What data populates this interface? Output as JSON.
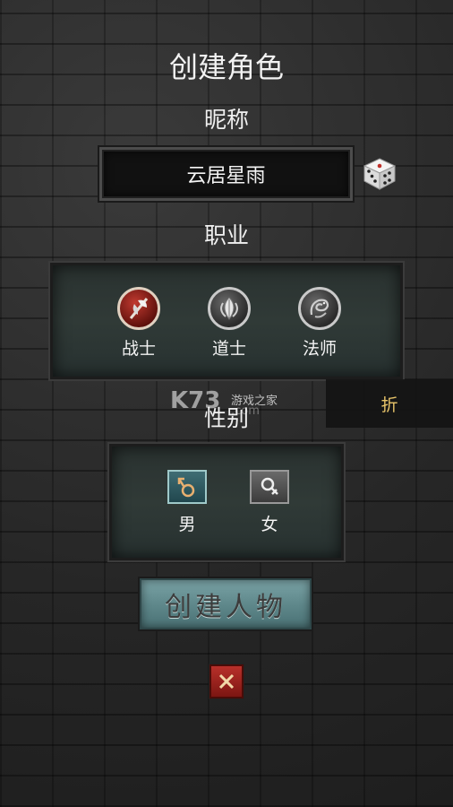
{
  "page": {
    "title": "创建角色"
  },
  "nickname": {
    "label": "昵称",
    "value": "云居星雨",
    "random_icon": "dice-icon"
  },
  "class_section": {
    "label": "职业",
    "options": [
      {
        "label": "战士",
        "icon": "axe-icon",
        "selected": true
      },
      {
        "label": "道士",
        "icon": "leaf-icon",
        "selected": false
      },
      {
        "label": "法师",
        "icon": "dragon-icon",
        "selected": false
      }
    ]
  },
  "gender_section": {
    "label": "性别",
    "options": [
      {
        "label": "男",
        "icon": "male-icon",
        "selected": true
      },
      {
        "label": "女",
        "icon": "female-icon",
        "selected": false
      }
    ]
  },
  "actions": {
    "create_label": "创建人物",
    "close_icon": "close-icon"
  },
  "overlay": {
    "watermark_logo": "K73",
    "watermark_text": "游戏之家",
    "watermark_domain": ".com",
    "discount_tab": "折"
  },
  "colors": {
    "selected_class": "#c03a30",
    "selected_gender": "#3f6d74",
    "create_button": "#6f999c",
    "close_button": "#b8302a",
    "discount_text": "#e9c56a"
  }
}
